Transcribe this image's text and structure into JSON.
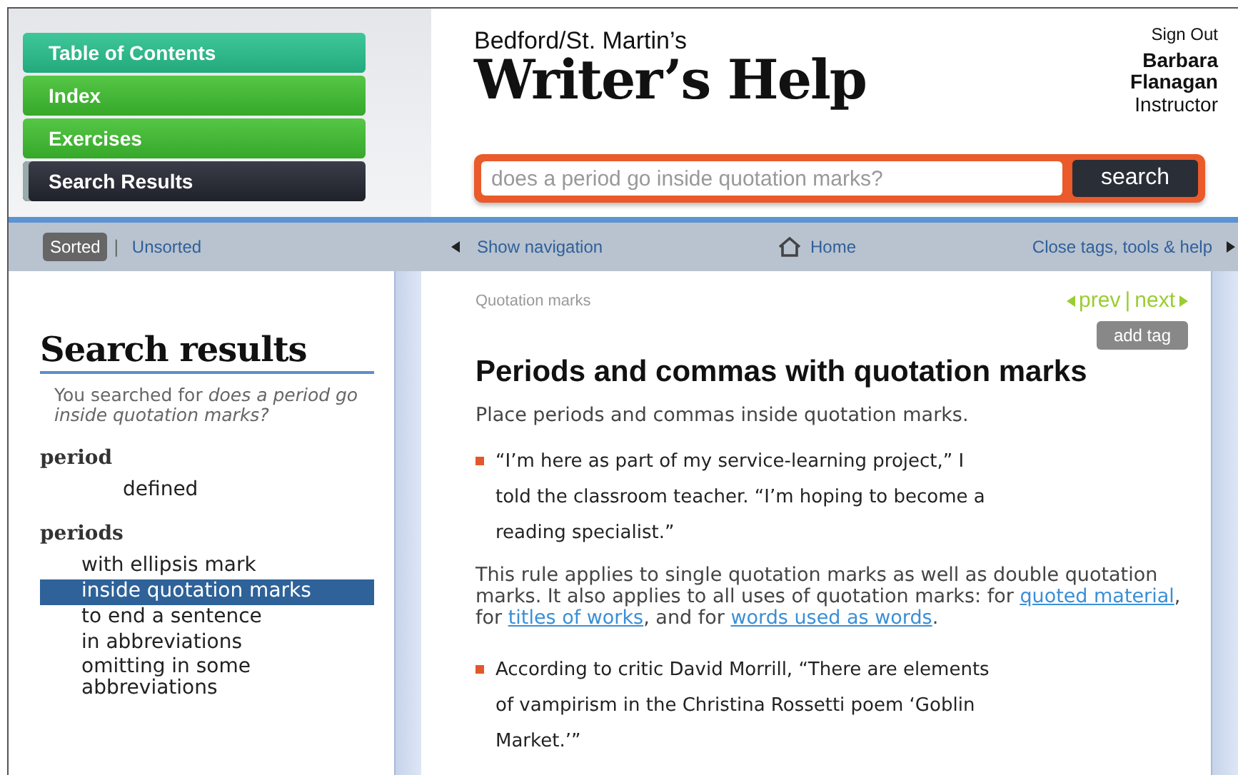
{
  "nav_buttons": [
    {
      "label": "Table of Contents",
      "kind": "teal",
      "selected": false
    },
    {
      "label": "Index",
      "kind": "green",
      "selected": false
    },
    {
      "label": "Exercises",
      "kind": "green",
      "selected": false
    },
    {
      "label": "Search Results",
      "kind": "dark",
      "selected": true
    }
  ],
  "brand": {
    "publisher": "Bedford/St. Martin’s",
    "title": "Writer’s Help"
  },
  "user": {
    "sign_out": "Sign Out",
    "name": "Barbara Flanagan",
    "role": "Instructor"
  },
  "search": {
    "placeholder": "does a period go inside quotation marks?",
    "button": "search"
  },
  "sort_tabs": [
    {
      "label": "Sorted",
      "selected": true
    },
    {
      "label": "Unsorted",
      "selected": false
    }
  ],
  "sort_separator": "|",
  "toolbar": {
    "left": "Show navigation",
    "home": "Home",
    "right": "Close tags, tools & help"
  },
  "sidebar": {
    "title": "Search results",
    "query_intro": "You searched for *does a period go inside quotation marks?*",
    "groups": [
      {
        "heading": "period",
        "entries": [
          {
            "label": "defined",
            "selected": false
          }
        ]
      },
      {
        "heading": "periods",
        "entries": [
          {
            "label": "with ellipsis mark",
            "selected": false
          },
          {
            "label": "inside quotation marks",
            "selected": true
          },
          {
            "label": "to end a sentence",
            "selected": false
          },
          {
            "label": "in abbreviations",
            "selected": false
          },
          {
            "label": "omitting in some abbreviations",
            "selected": false
          }
        ]
      }
    ]
  },
  "article": {
    "breadcrumb": "Quotation marks",
    "prev": "prev",
    "pager_separator": "|",
    "next": "next",
    "add_tag": "add tag",
    "title": "Periods and commas with quotation marks",
    "intro": "Place periods and commas inside quotation marks.",
    "blocks": [
      {
        "kind": "example",
        "text": "“I’m here as part of my service-learning project,” I told the classroom teacher. “I’m hoping to become a reading specialist.”"
      },
      {
        "kind": "paragraph",
        "parts": [
          {
            "kind": "text",
            "text": "This rule applies to single quotation marks as well as double quotation marks. It also applies to all uses of quotation marks: for "
          },
          {
            "kind": "link",
            "text": "quoted material"
          },
          {
            "kind": "text",
            "text": ", for "
          },
          {
            "kind": "link",
            "text": "titles of works"
          },
          {
            "kind": "text",
            "text": ", and for "
          },
          {
            "kind": "link",
            "text": "words used as words"
          },
          {
            "kind": "text",
            "text": "."
          }
        ]
      },
      {
        "kind": "example",
        "text": "According to critic David Morrill, “There are elements of vampirism in the Christina Rossetti poem ‘Goblin Market.’”"
      }
    ]
  }
}
